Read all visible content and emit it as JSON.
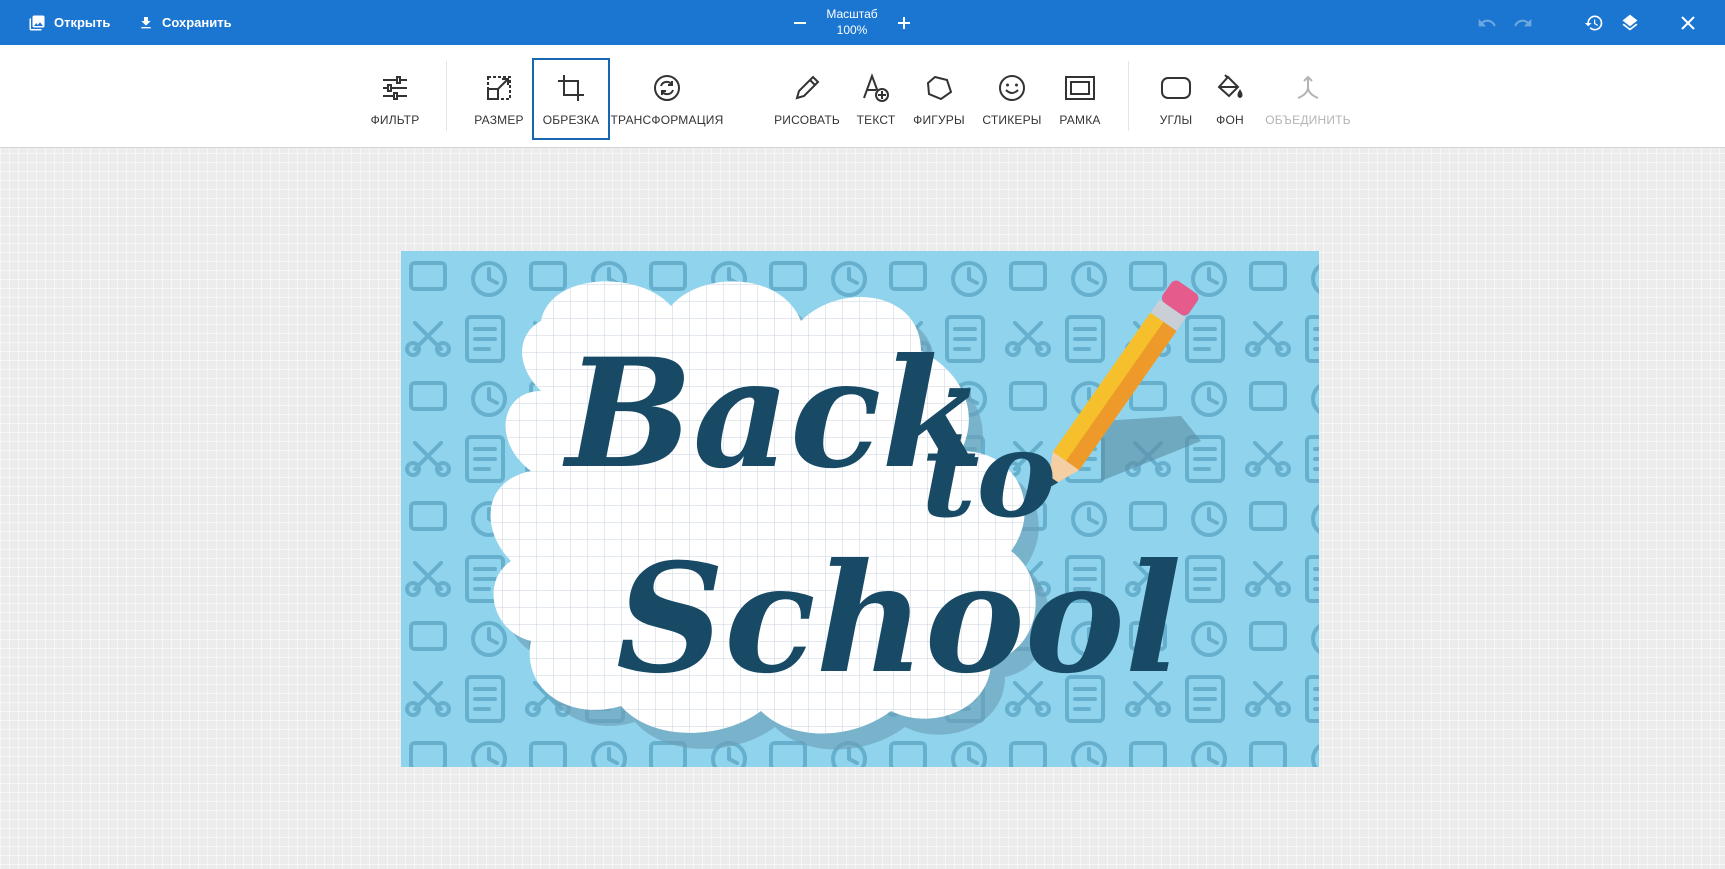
{
  "topbar": {
    "open_label": "Открыть",
    "save_label": "Сохранить",
    "zoom_label": "Масштаб",
    "zoom_value": "100%"
  },
  "tools": [
    {
      "label": "ФИЛЬТР",
      "icon": "sliders-icon"
    },
    {
      "label": "РАЗМЕР",
      "icon": "resize-icon"
    },
    {
      "label": "ОБРЕЗКА",
      "icon": "crop-icon",
      "active": true
    },
    {
      "label": "ТРАНСФОРМАЦИЯ",
      "icon": "rotate-icon"
    },
    {
      "label": "РИСОВАТЬ",
      "icon": "pencil-icon"
    },
    {
      "label": "ТЕКСТ",
      "icon": "text-add-icon"
    },
    {
      "label": "ФИГУРЫ",
      "icon": "shapes-icon"
    },
    {
      "label": "СТИКЕРЫ",
      "icon": "smiley-icon"
    },
    {
      "label": "РАМКА",
      "icon": "frame-icon"
    },
    {
      "label": "УГЛЫ",
      "icon": "rounded-corners-icon"
    },
    {
      "label": "ФОН",
      "icon": "paint-bucket-icon"
    },
    {
      "label": "ОБЪЕДИНИТЬ",
      "icon": "merge-icon",
      "disabled": true
    }
  ],
  "artwork": {
    "line1": "Back",
    "line2": "to",
    "line3": "School"
  },
  "colors": {
    "topbar": "#1b76d1",
    "active_border": "#1767b0",
    "artwork_bg": "#8fd3ec",
    "artwork_text": "#184a66"
  }
}
